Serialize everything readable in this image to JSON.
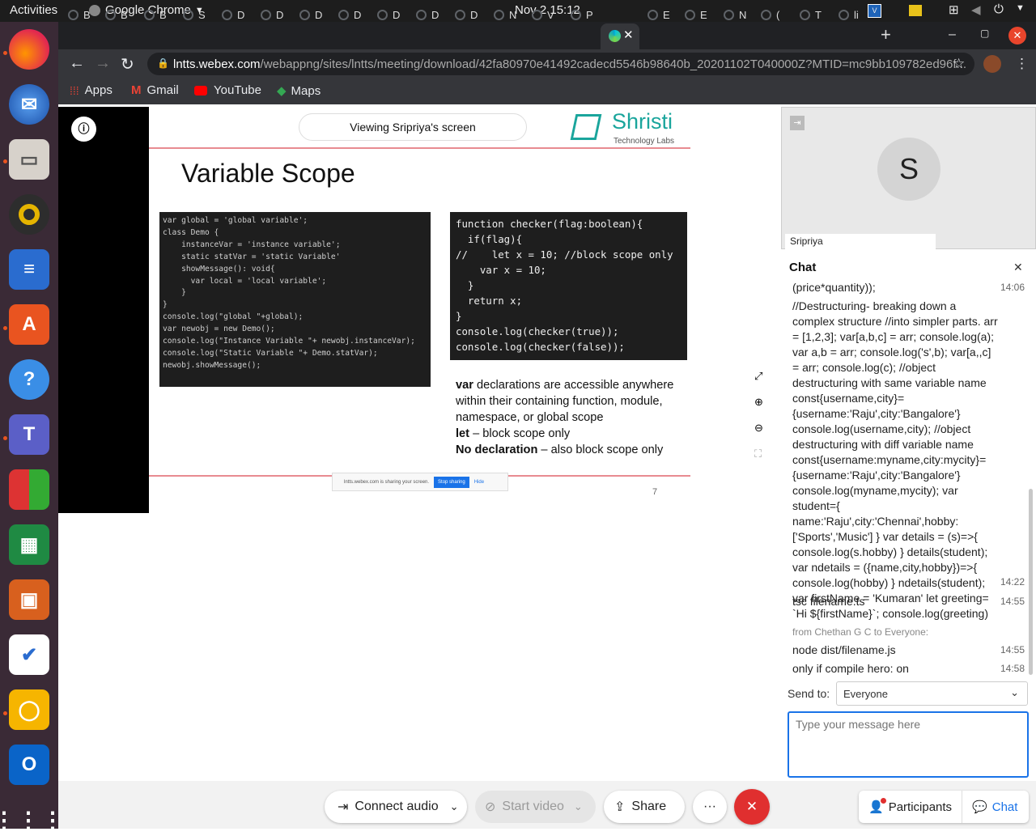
{
  "system": {
    "activities": "Activities",
    "app": "Google Chrome",
    "clock": "Nov 2  15:12"
  },
  "tabs": [
    {
      "t": "B"
    },
    {
      "t": "B"
    },
    {
      "t": "B"
    },
    {
      "t": "S"
    },
    {
      "t": "D"
    },
    {
      "t": "D"
    },
    {
      "t": "D"
    },
    {
      "t": "D"
    },
    {
      "t": "D"
    },
    {
      "t": "D"
    },
    {
      "t": "D"
    },
    {
      "t": "N"
    },
    {
      "t": "V"
    },
    {
      "t": "P"
    },
    {
      "t": "E"
    },
    {
      "t": "E"
    },
    {
      "t": "N"
    },
    {
      "t": "("
    },
    {
      "t": "T"
    },
    {
      "t": "li"
    }
  ],
  "address": {
    "domain": "lntts.webex.com",
    "path": "/webappng/sites/lntts/meeting/download/42fa80970e41492cadecd5546b98640b_20201102T040000Z?MTID=mc9bb109782ed96f..."
  },
  "bookmarks": [
    {
      "label": "Apps"
    },
    {
      "label": "Gmail"
    },
    {
      "label": "YouTube"
    },
    {
      "label": "Maps"
    }
  ],
  "viewer": {
    "banner": "Viewing Sripriya's screen"
  },
  "slide": {
    "title": "Variable Scope",
    "logo_name": "Shristi",
    "logo_sub": "Technology Labs",
    "code_left": "var global = 'global variable';\nclass Demo {\n    instanceVar = 'instance variable';\n    static statVar = 'static Variable'\n    showMessage(): void{\n      var local = 'local variable';\n    }\n}\nconsole.log(\"global \"+global);\nvar newobj = new Demo();\nconsole.log(\"Instance Variable \"+ newobj.instanceVar);\nconsole.log(\"Static Variable \"+ Demo.statVar);\nnewobj.showMessage();",
    "code_right": "function checker(flag:boolean){\n  if(flag){\n//    let x = 10; //block scope only\n    var x = 10;\n  }\n  return x;\n}\nconsole.log(checker(true));\nconsole.log(checker(false));",
    "p1_b": "var",
    "p1": " declarations are accessible anywhere within their containing function, module, namespace, or global scope",
    "p2_b": "let",
    "p2": " – block scope only",
    "p3_b": "No declaration",
    "p3": " – also block scope only",
    "sharing_msg": "lntts.webex.com is sharing your screen.",
    "stop": "Stop sharing",
    "hide": "Hide",
    "page": "7"
  },
  "participant": {
    "initial": "S",
    "name": "Sripriya"
  },
  "chat": {
    "title": "Chat",
    "messages": [
      {
        "text": "(price*quantity));",
        "time": "14:06"
      },
      {
        "text": "//Destructuring- breaking down a complex structure //into simpler parts. arr = [1,2,3]; var[a,b,c] = arr; console.log(a); var a,b = arr; console.log('s',b); var[a,,c] = arr; console.log(c); //object destructuring with same variable name const{username,city}={username:'Raju',city:'Bangalore'} console.log(username,city); //object destructuring with diff variable name const{username:myname,city:mycity}={username:'Raju',city:'Bangalore'} console.log(myname,mycity); var student={ name:'Raju',city:'Chennai',hobby:['Sports','Music'] } var details = (s)=>{ console.log(s.hobby) } details(student); var ndetails = ({name,city,hobby})=>{ console.log(hobby) } ndetails(student); var firstName = 'Kumaran' let greeting= `Hi ${firstName}`; console.log(greeting)",
        "time": "14:22"
      },
      {
        "text": "tsc filename.ts",
        "time": "14:55"
      }
    ],
    "from": "from Chethan G C to Everyone:",
    "messages2": [
      {
        "text": "node dist/filename.js",
        "time": "14:55"
      },
      {
        "text": "only if compile hero: on",
        "time": "14:58"
      }
    ],
    "send_to_label": "Send to:",
    "send_to_value": "Everyone",
    "placeholder": "Type your message here"
  },
  "controls": {
    "audio": "Connect audio",
    "video": "Start video",
    "share": "Share",
    "more": "···",
    "participants": "Participants",
    "chat": "Chat"
  }
}
